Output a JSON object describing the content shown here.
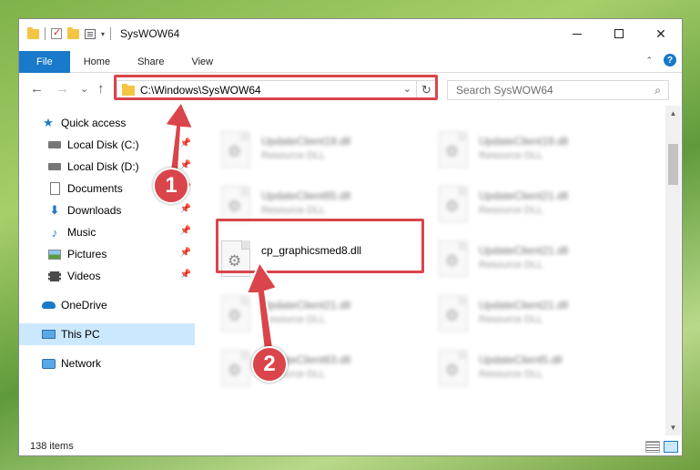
{
  "window": {
    "title": "SysWOW64",
    "controls": {
      "minimize": "",
      "maximize": "",
      "close": "✕"
    },
    "quick_access_dropdown": "▾"
  },
  "ribbon": {
    "tabs": [
      {
        "label": "File"
      },
      {
        "label": "Home"
      },
      {
        "label": "Share"
      },
      {
        "label": "View"
      }
    ],
    "collapse_glyph": "⌃",
    "help_glyph": "?"
  },
  "navbar": {
    "back_glyph": "←",
    "forward_glyph": "→",
    "recent_glyph": "⌄",
    "up_glyph": "↑",
    "address": "C:\\Windows\\SysWOW64",
    "address_dropdown": "⌄",
    "refresh_glyph": "↻",
    "search_placeholder": "Search SysWOW64",
    "search_glyph": "⌕"
  },
  "sidebar": {
    "items": [
      {
        "label": "Quick access",
        "icon": "star-icon"
      },
      {
        "label": "Local Disk (C:)",
        "icon": "disk-icon",
        "pinned": true
      },
      {
        "label": "Local Disk (D:)",
        "icon": "disk-icon",
        "pinned": true
      },
      {
        "label": "Documents",
        "icon": "documents-icon",
        "pinned": true
      },
      {
        "label": "Downloads",
        "icon": "downloads-icon",
        "pinned": true
      },
      {
        "label": "Music",
        "icon": "music-icon",
        "pinned": true
      },
      {
        "label": "Pictures",
        "icon": "pictures-icon",
        "pinned": true
      },
      {
        "label": "Videos",
        "icon": "videos-icon",
        "pinned": true
      },
      {
        "label": "OneDrive",
        "icon": "onedrive-icon"
      },
      {
        "label": "This PC",
        "icon": "pc-icon",
        "selected": true
      },
      {
        "label": "Network",
        "icon": "network-icon"
      }
    ],
    "pin_glyph": "📌"
  },
  "files": {
    "left_column": [
      {
        "name": "UpdateClient19.dll",
        "type": "Resource DLL"
      },
      {
        "name": "UpdateClient65.dll",
        "type": "Resource DLL"
      },
      {
        "name": "cp_graphicsmed8.dll",
        "type": ""
      },
      {
        "name": "UpdateClient21.dll",
        "type": "Resource DLL"
      },
      {
        "name": "UpdateClient63.dll",
        "type": "Resource DLL"
      }
    ],
    "right_column": [
      {
        "name": "UpdateClient19.dll",
        "type": "Resource DLL"
      },
      {
        "name": "UpdateClient21.dll",
        "type": "Resource DLL"
      },
      {
        "name": "UpdateClient21.dll",
        "type": "Resource DLL"
      },
      {
        "name": "UpdateClient21.dll",
        "type": "Resource DLL"
      },
      {
        "name": "UpdateClient5.dll",
        "type": "Resource DLL"
      }
    ],
    "gear_glyph": "⚙"
  },
  "scrollbar": {
    "up_glyph": "▲",
    "down_glyph": "▼"
  },
  "status": {
    "item_count": "138 items"
  },
  "annotations": {
    "step1": "1",
    "step2": "2",
    "color": "#d9454b"
  }
}
